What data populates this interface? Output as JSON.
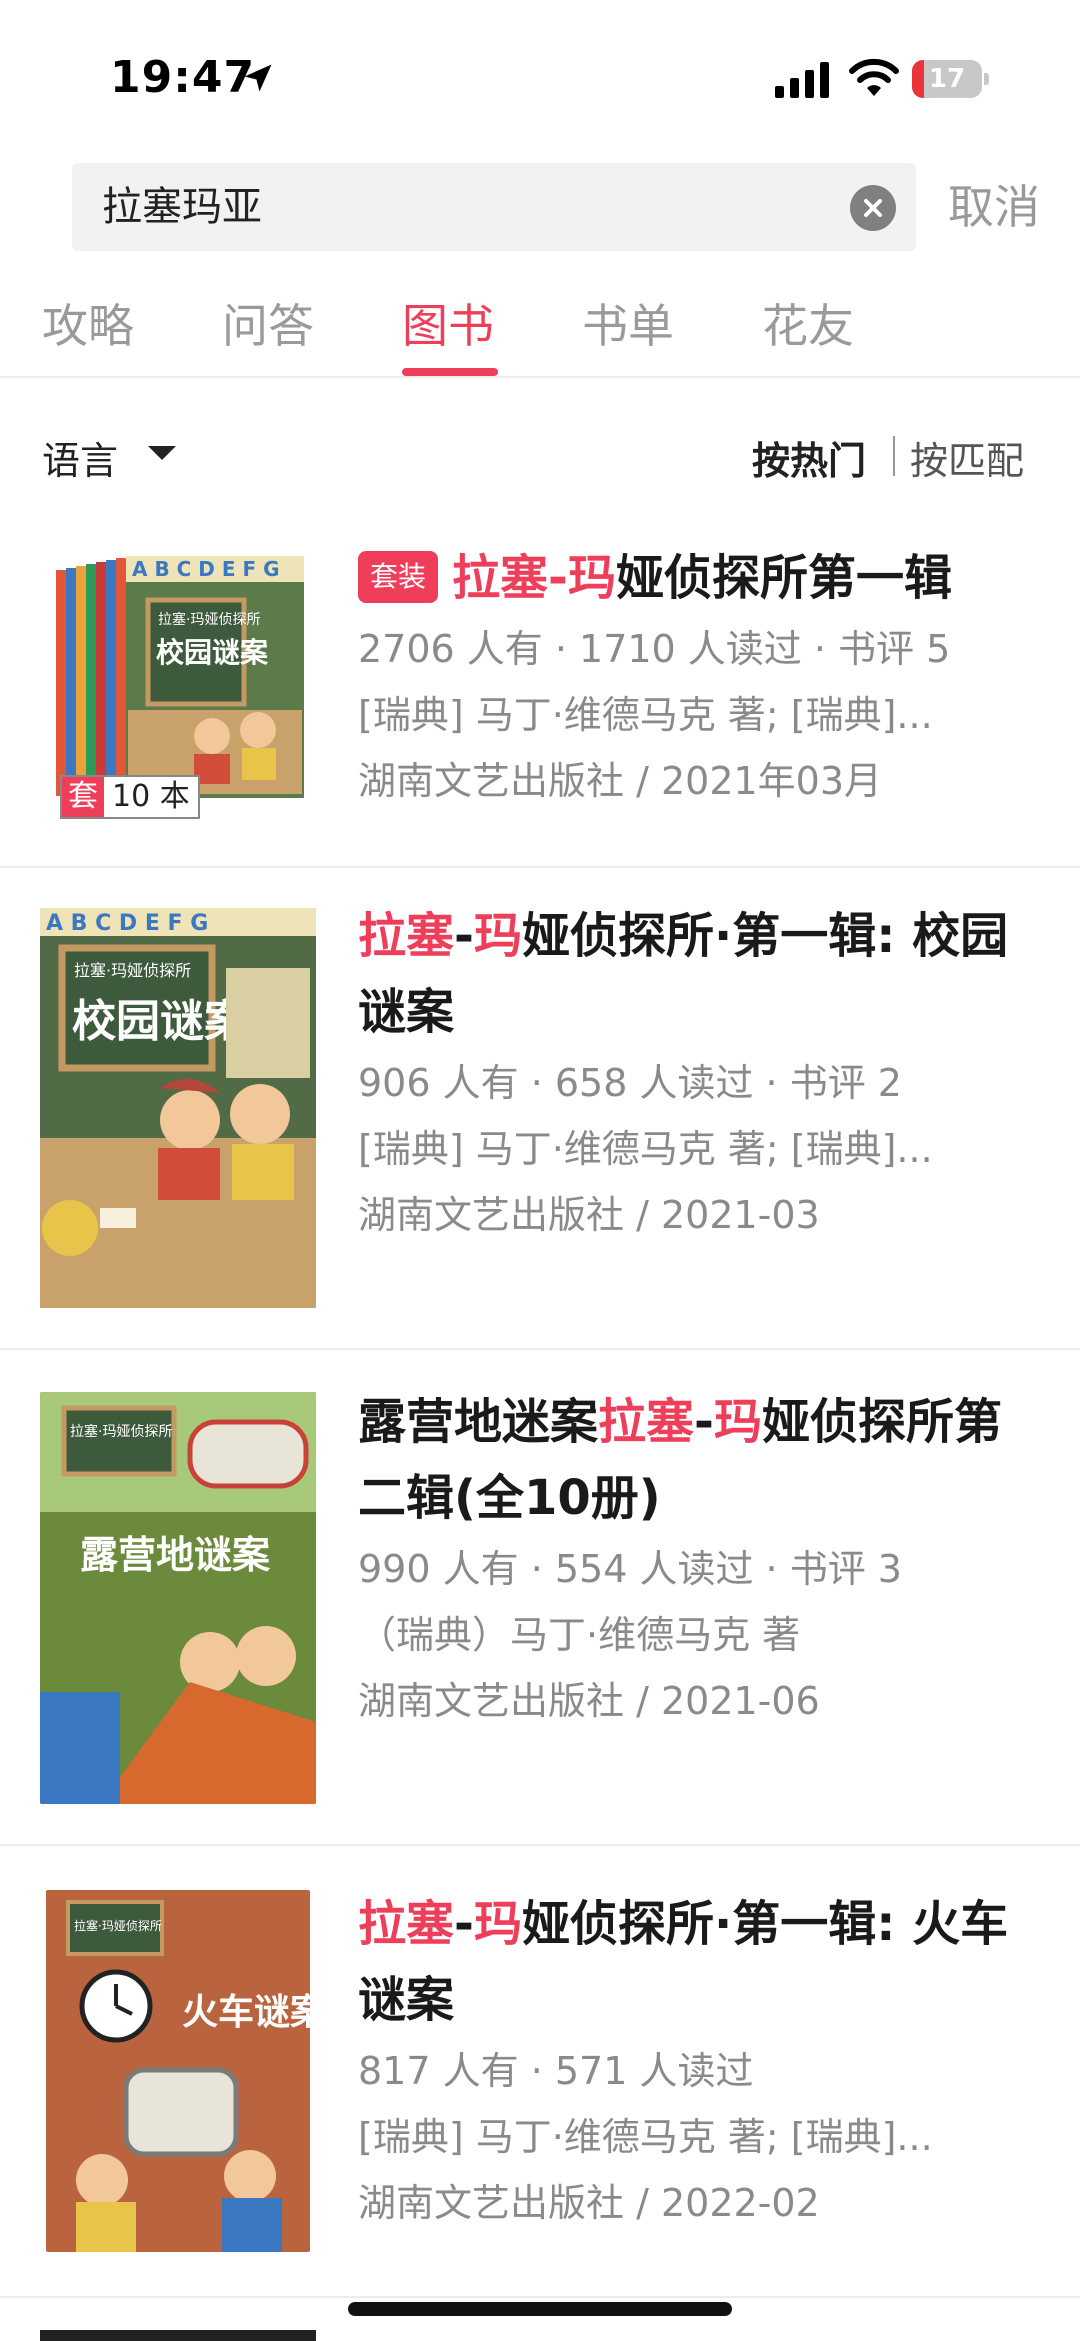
{
  "status_bar": {
    "time": "19:47",
    "battery": "17",
    "battery_level": 0.17
  },
  "search": {
    "query": "拉塞玛亚",
    "cancel_label": "取消"
  },
  "tabs": [
    {
      "label": "攻略"
    },
    {
      "label": "问答"
    },
    {
      "label": "图书",
      "active": true
    },
    {
      "label": "书单"
    },
    {
      "label": "花友"
    }
  ],
  "filter": {
    "language_label": "语言",
    "sort_hot": "按热门",
    "sort_match": "按匹配"
  },
  "books": [
    {
      "tag": "套装",
      "title_parts": [
        "拉塞",
        "-",
        "玛",
        "娅侦探所第一辑"
      ],
      "stats": "2706 人有 · 1710 人读过 · 书评 5",
      "author": "[瑞典] 马丁·维德马克 著; [瑞典]...",
      "publisher": "湖南文艺出版社 / 2021年03月",
      "set_badge_label": "套",
      "set_badge_count": "10 本"
    },
    {
      "title_parts": [
        "拉塞",
        "-",
        "玛",
        "娅侦探所·第一辑: 校园谜案"
      ],
      "stats": "906 人有 · 658 人读过 · 书评 2",
      "author": "[瑞典] 马丁·维德马克 著; [瑞典]...",
      "publisher": "湖南文艺出版社 / 2021-03"
    },
    {
      "title_parts": [
        "露营地迷案",
        "拉塞",
        "-",
        "玛",
        "娅侦探所第二辑(全10册)"
      ],
      "stats": "990 人有 · 554 人读过 · 书评 3",
      "author": "（瑞典）马丁·维德马克 著",
      "publisher": "湖南文艺出版社 / 2021-06"
    },
    {
      "title_parts": [
        "拉塞",
        "-",
        "玛",
        "娅侦探所·第一辑: 火车谜案"
      ],
      "stats": "817 人有 · 571 人读过",
      "author": "[瑞典] 马丁·维德马克 著; [瑞典]...",
      "publisher": "湖南文艺出版社 / 2022-02"
    }
  ],
  "covers": [
    {
      "series": "拉塞·玛娅侦探所",
      "title": "校园谜案"
    },
    {
      "series": "拉塞·玛娅侦探所",
      "title": "校园谜案"
    },
    {
      "series": "拉塞·玛娅侦探所",
      "title": "露营地谜案"
    },
    {
      "series": "拉塞·玛娅侦探所",
      "title": "火车谜案"
    }
  ],
  "colors": {
    "accent": "#ee3e5a",
    "text": "#1a1a1a",
    "muted": "#8a8a8a"
  }
}
